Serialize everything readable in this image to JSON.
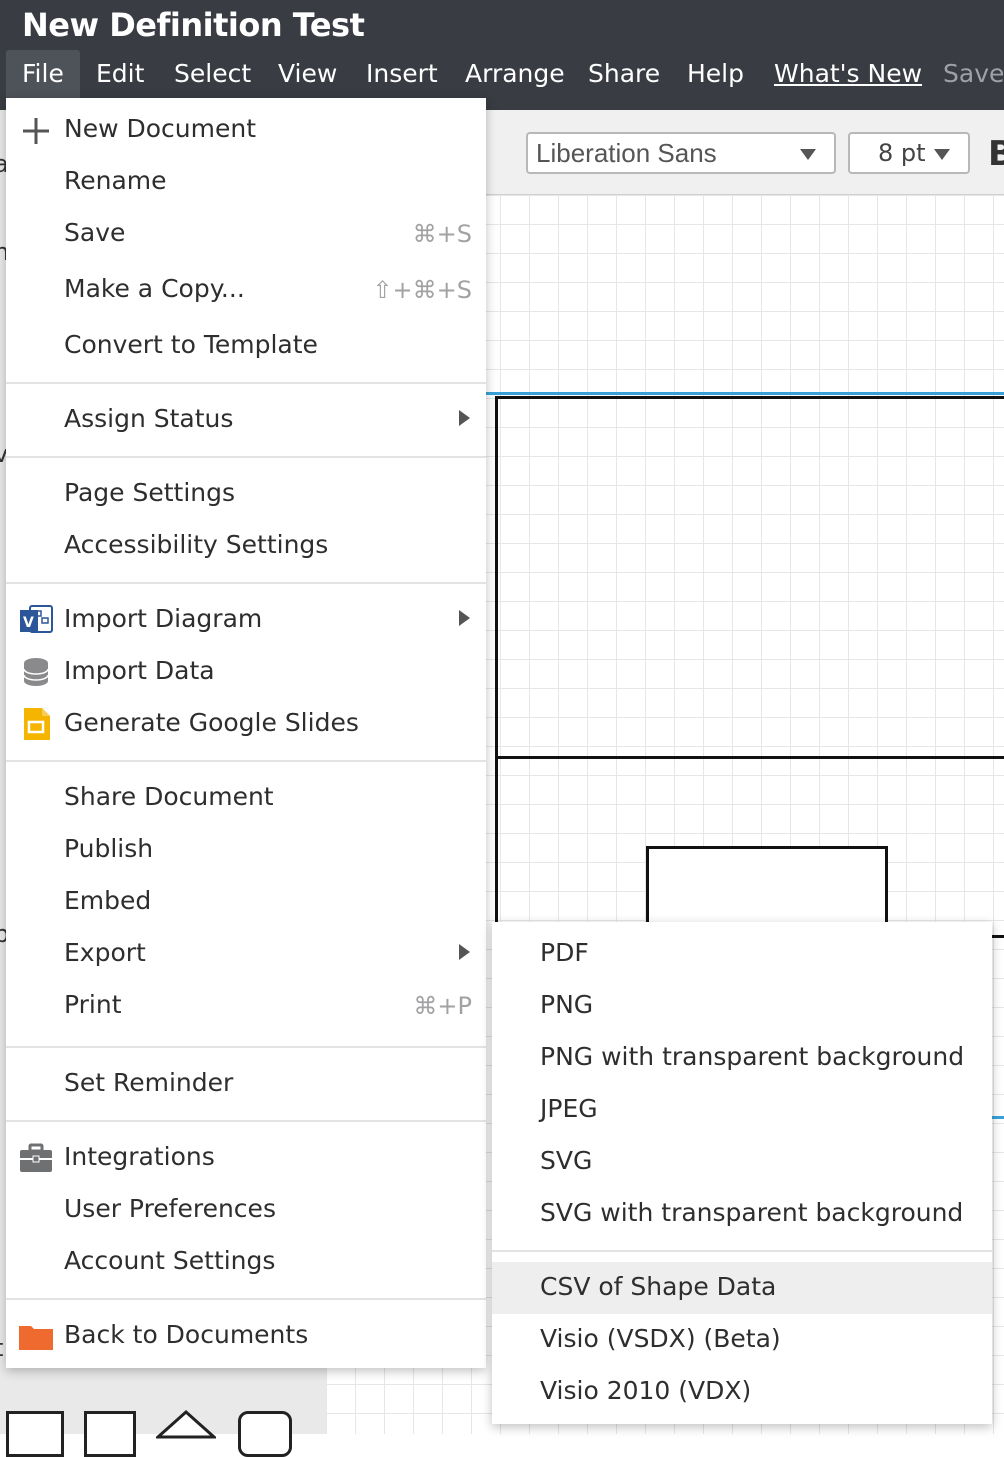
{
  "app": {
    "doc_title": "New Definition Test",
    "menubar": [
      {
        "label": "File"
      },
      {
        "label": "Edit"
      },
      {
        "label": "Select"
      },
      {
        "label": "View"
      },
      {
        "label": "Insert"
      },
      {
        "label": "Arrange"
      },
      {
        "label": "Share"
      },
      {
        "label": "Help"
      },
      {
        "label": "What's New"
      },
      {
        "label": "Saved"
      }
    ]
  },
  "toolbar": {
    "font_family_value": "Liberation Sans",
    "font_size_value": "8 pt",
    "bold_label": "B"
  },
  "left_edge_fragments": [
    "a",
    "n",
    "v",
    "p",
    "t"
  ],
  "file_menu": {
    "items": [
      {
        "label": "New Document",
        "icon": "plus-icon"
      },
      {
        "label": "Rename"
      },
      {
        "label": "Save",
        "shortcut": "⌘+S"
      },
      {
        "label": "Make a Copy...",
        "shortcut": "⇧+⌘+S"
      },
      {
        "label": "Convert to Template"
      },
      {
        "label": "Assign Status",
        "submenu": true
      },
      {
        "label": "Page Settings"
      },
      {
        "label": "Accessibility Settings"
      },
      {
        "label": "Import Diagram",
        "icon": "visio-icon",
        "submenu": true
      },
      {
        "label": "Import Data",
        "icon": "database-icon"
      },
      {
        "label": "Generate Google Slides",
        "icon": "google-slides-icon"
      },
      {
        "label": "Share Document"
      },
      {
        "label": "Publish"
      },
      {
        "label": "Embed"
      },
      {
        "label": "Export",
        "submenu": true
      },
      {
        "label": "Print",
        "shortcut": "⌘+P"
      },
      {
        "label": "Set Reminder"
      },
      {
        "label": "Integrations",
        "icon": "briefcase-icon"
      },
      {
        "label": "User Preferences"
      },
      {
        "label": "Account Settings"
      },
      {
        "label": "Back to Documents",
        "icon": "folder-icon"
      }
    ]
  },
  "export_menu": {
    "items": [
      {
        "label": "PDF"
      },
      {
        "label": "PNG"
      },
      {
        "label": "PNG with transparent background"
      },
      {
        "label": "JPEG"
      },
      {
        "label": "SVG"
      },
      {
        "label": "SVG with transparent background"
      },
      {
        "label": "CSV of Shape Data",
        "highlighted": true
      },
      {
        "label": "Visio (VSDX) (Beta)"
      },
      {
        "label": "Visio 2010 (VDX)"
      }
    ]
  },
  "colors": {
    "appbar": "#393c43",
    "selection": "#38a2d8",
    "folder": "#ef6a2e",
    "slides": "#f4b400",
    "visio": "#2b579a"
  }
}
